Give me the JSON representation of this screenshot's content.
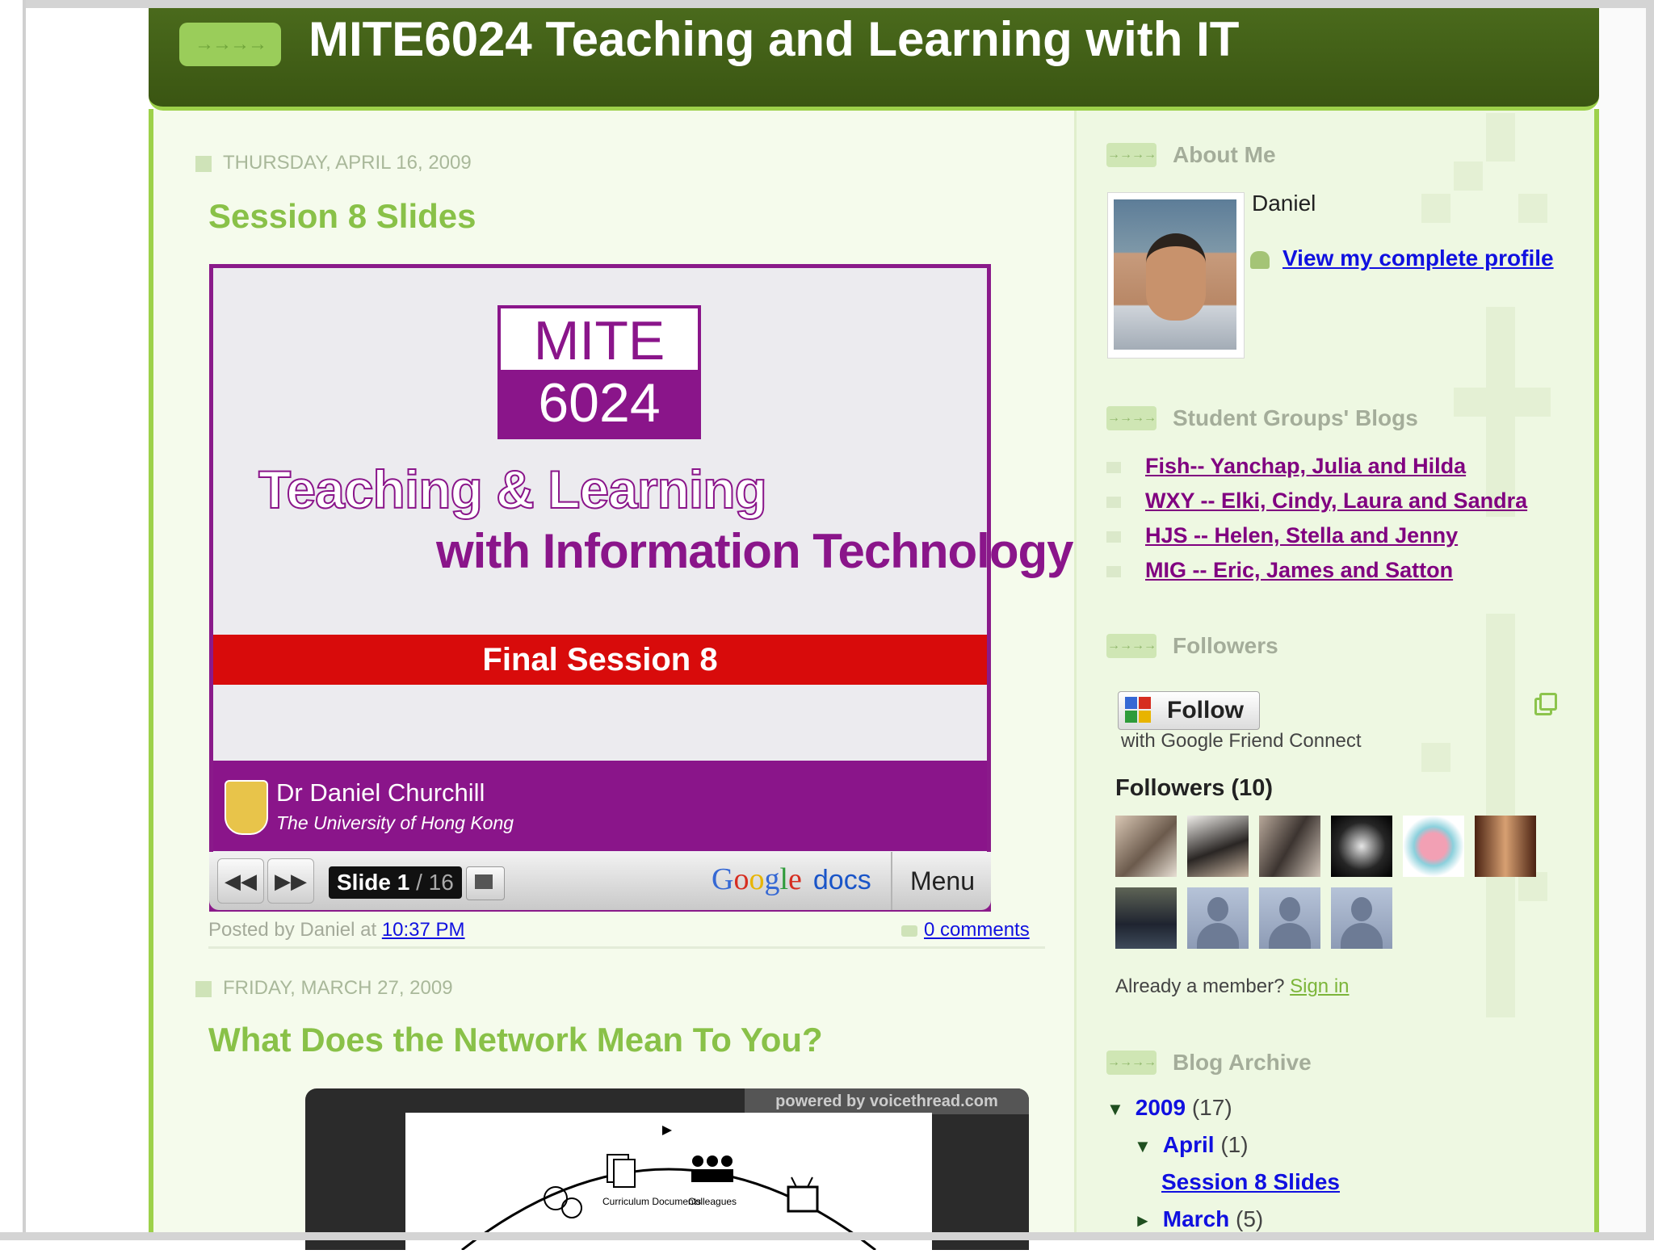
{
  "header": {
    "title": "MITE6024 Teaching and Learning with IT"
  },
  "posts": [
    {
      "date": "THURSDAY, APRIL 16, 2009",
      "title": "Session 8 Slides",
      "slide": {
        "code_top": "MITE",
        "code_bottom": "6024",
        "line1": "Teaching & Learning",
        "line2": "with Information Technology",
        "session": "Final Session 8",
        "author": "Dr Daniel Churchill",
        "university": "The University of Hong Kong"
      },
      "viewer": {
        "slide_word": "Slide",
        "current": "1",
        "total": "/ 16",
        "docs_label": "docs",
        "menu_label": "Menu"
      },
      "posted_by": "Posted by Daniel",
      "at_word": "at",
      "time": "10:37 PM",
      "comments": "0 comments"
    },
    {
      "date": "FRIDAY, MARCH 27, 2009",
      "title": "What Does the Network Mean To You?",
      "embed_badge": "powered by voicethread.com",
      "diagram_labels": [
        "Curriculum Documents",
        "Colleagues"
      ]
    }
  ],
  "sidebar": {
    "about": {
      "heading": "About Me",
      "name": "Daniel",
      "profile_link": "View my complete profile"
    },
    "blogs": {
      "heading": "Student Groups' Blogs",
      "items": [
        "Fish-- Yanchap, Julia and Hilda",
        "WXY -- Elki, Cindy, Laura and Sandra",
        "HJS -- Helen, Stella and Jenny",
        "MIG -- Eric, James and Satton"
      ]
    },
    "followers": {
      "heading": "Followers",
      "follow_label": "Follow",
      "gfc_text": "with Google Friend Connect",
      "count_label": "Followers (10)",
      "already": "Already a member?",
      "sign_in": "Sign in"
    },
    "archive": {
      "heading": "Blog Archive",
      "year": "2009",
      "year_count": "(17)",
      "month": "April",
      "month_count": "(1)",
      "post": "Session 8 Slides",
      "next_month": "March",
      "next_month_count": "(5)"
    }
  }
}
